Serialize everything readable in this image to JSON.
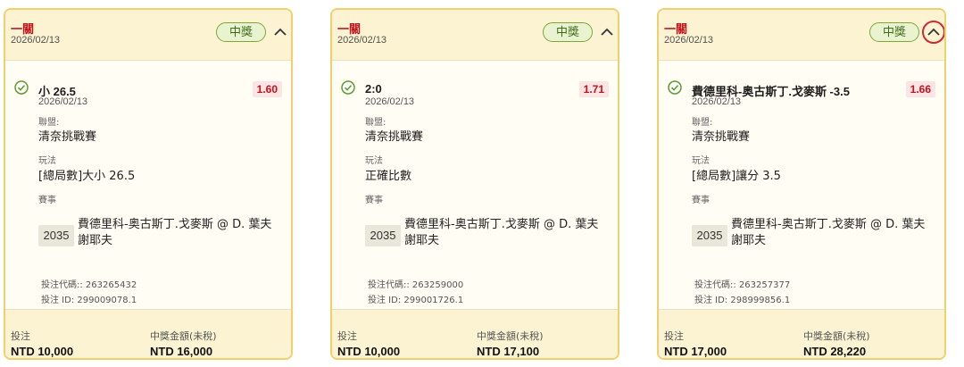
{
  "tickets": [
    {
      "leg_title": "一關",
      "leg_date": "2026/02/13",
      "status": "中獎",
      "selection": "小 26.5",
      "selection_date": "2026/02/13",
      "odds": "1.60",
      "league_label": "聯盟:",
      "league": "清奈挑戰賽",
      "market_label": "玩法",
      "market": "[總局數]大小 26.5",
      "event_label": "賽事",
      "event_id": "2035",
      "event_name": "費德里科-奥古斯丁.戈麥斯 @ D. 葉夫謝耶夫",
      "bet_code": "投注代碼:: 263265432",
      "bet_id": "投注 ID: 299009078.1",
      "stake_label": "投注",
      "stake": "NTD 10,000",
      "payout_label": "中獎金額(未稅)",
      "payout": "NTD 16,000"
    },
    {
      "leg_title": "一關",
      "leg_date": "2026/02/13",
      "status": "中獎",
      "selection": "2:0",
      "selection_date": "2026/02/13",
      "odds": "1.71",
      "league_label": "聯盟:",
      "league": "清奈挑戰賽",
      "market_label": "玩法",
      "market": "正確比數",
      "event_label": "賽事",
      "event_id": "2035",
      "event_name": "費德里科-奥古斯丁.戈麥斯 @ D. 葉夫謝耶夫",
      "bet_code": "投注代碼:: 263259000",
      "bet_id": "投注 ID: 299001726.1",
      "stake_label": "投注",
      "stake": "NTD 10,000",
      "payout_label": "中獎金額(未稅)",
      "payout": "NTD 17,100"
    },
    {
      "leg_title": "一關",
      "leg_date": "2026/02/13",
      "status": "中獎",
      "selection": "費德里科-奥古斯丁.戈麥斯 -3.5",
      "selection_date": "2026/02/13",
      "odds": "1.66",
      "league_label": "聯盟:",
      "league": "清奈挑戰賽",
      "market_label": "玩法",
      "market": "[總局數]讓分 3.5",
      "event_label": "賽事",
      "event_id": "2035",
      "event_name": "費德里科-奥古斯丁.戈麥斯 @ D. 葉夫謝耶夫",
      "bet_code": "投注代碼:: 263257377",
      "bet_id": "投注 ID: 298999856.1",
      "stake_label": "投注",
      "stake": "NTD 17,000",
      "payout_label": "中獎金額(未稅)",
      "payout": "NTD 28,220"
    }
  ],
  "icons": {
    "status_check": "check-circle-icon",
    "collapse": "chevron-up-icon"
  },
  "colors": {
    "card_border": "#f1cf6b",
    "card_header_bg": "#fbf3d2",
    "leg_title": "#c0141c",
    "status_green": "#7ea63a",
    "odds_bg": "#fbe4e4",
    "odds_text": "#c0141c",
    "focus_ring": "#cc2b33"
  }
}
